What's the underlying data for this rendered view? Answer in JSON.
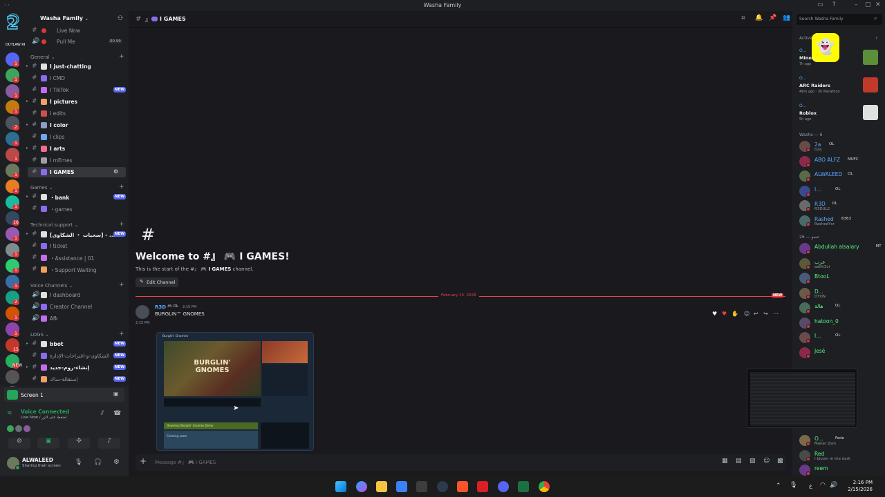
{
  "window": {
    "title": "Washa Family"
  },
  "server": {
    "name": "Washa Family",
    "guild_badges": [
      "1",
      "1",
      "1",
      "1",
      "2",
      "1",
      "1",
      "1",
      "1",
      "1",
      "16",
      "1",
      "1",
      "1",
      "1",
      "2",
      "1",
      "1",
      "15",
      "NEW"
    ],
    "guild_tag": "OUTLAW RP"
  },
  "channels_top": [
    {
      "label": "Live Now"
    },
    {
      "label": "Pull Me",
      "count": "00 99"
    }
  ],
  "categories": {
    "general": "General",
    "games": "Games",
    "support": "Technical support",
    "voice": "Voice Channels",
    "logs": "LOGS"
  },
  "channels_general": [
    {
      "label": "I just-chatting",
      "bold": true
    },
    {
      "label": "I CMD"
    },
    {
      "label": "I TikTok",
      "badge": "NEW"
    },
    {
      "label": "I pictures",
      "bold": true
    },
    {
      "label": "I edits"
    },
    {
      "label": "I color",
      "bold": true
    },
    {
      "label": "I clips"
    },
    {
      "label": "I arts",
      "bold": true
    },
    {
      "label": "I mEmes"
    },
    {
      "label": "I GAMES",
      "selected": true
    }
  ],
  "channels_games": [
    {
      "label": "・bank",
      "bold": true,
      "badge": "NEW"
    },
    {
      "label": "・games"
    }
  ],
  "channels_support": [
    {
      "label": "[سحبات ・ الشكاوى] - ...",
      "bold": true,
      "badge": "NEW"
    },
    {
      "label": "I ticket"
    },
    {
      "label": "・Assistance | 01"
    },
    {
      "label": "・Support Waiting"
    }
  ],
  "channels_voice": [
    {
      "label": "I dashboard"
    },
    {
      "label": "Creator Channel"
    },
    {
      "label": "Afk"
    }
  ],
  "channels_logs": [
    {
      "label": "bbot",
      "bold": true,
      "badge": "NEW"
    },
    {
      "label": "الشكاوى-و-اقتراحات-الإدارة",
      "badge": "NEW"
    },
    {
      "label": "إنشاء-روم-جديد",
      "bold": true,
      "badge": "NEW"
    },
    {
      "label": "إستقالة-ساك",
      "badge": "NEW"
    }
  ],
  "screen_share": {
    "label": "Screen 1"
  },
  "voice": {
    "status": "Voice Connected",
    "sub": "Live Now / اضغط على الزر"
  },
  "user": {
    "name": "ALWALEED",
    "status": "Sharing their screen"
  },
  "header": {
    "channel": "I GAMES"
  },
  "search": {
    "placeholder": "Search Washa Family"
  },
  "welcome": {
    "title": "Welcome to #』 🎮 I GAMES!",
    "subtitle_pre": "This is the start of the #』 🎮 ",
    "subtitle_bold": "I GAMES",
    "subtitle_post": " channel.",
    "edit_button": "Edit Channel"
  },
  "divider": {
    "date": "February 15, 2026",
    "badge": "NEW"
  },
  "message": {
    "author": "R3D",
    "tag": "OL",
    "time": "2:15 PM",
    "side_time": "2:15 PM",
    "text": "BURGLIN™ GNOMES"
  },
  "embed": {
    "game_title": "BURGLIN' GNOMES",
    "store_header": "Burglin' Gnomes",
    "download_label": "Download Burglin' Gnomes Demo",
    "coming_soon": "Coming soon"
  },
  "composer": {
    "placeholder": "Message #』 🎮 I GAMES"
  },
  "activity": {
    "header": "Active Now",
    "items": [
      {
        "name": "O...",
        "game": "Minec...",
        "sub": "7h ago"
      },
      {
        "name": "O...",
        "game": "ARC Raiders",
        "sub": "46m ago  ·  3h Marathon"
      },
      {
        "name": "O...",
        "game": "Roblox",
        "sub": "5h ago"
      }
    ]
  },
  "member_groups": {
    "washa": "Washa — 6",
    "other": "عضو — 26"
  },
  "members_washa": [
    {
      "name": "2a",
      "tag": "OL",
      "sub": "b2a",
      "color": "#5aa8ff"
    },
    {
      "name": "ABO ALFZ",
      "tag": "MUFC",
      "sub": "",
      "color": "#5aa8ff"
    },
    {
      "name": "ALWALEED",
      "tag": "OL",
      "sub": "",
      "color": "#5aa8ff"
    },
    {
      "name": "I...",
      "tag": "OL",
      "sub": "",
      "color": "#5aa8ff"
    },
    {
      "name": "R3D",
      "tag": "OL",
      "sub": "R3DUL2",
      "color": "#5aa8ff"
    },
    {
      "name": "Rashed",
      "tag": "6363",
      "sub": "RashedYsr",
      "color": "#5aa8ff"
    }
  ],
  "members_other": [
    {
      "name": "Abdullah alsaiary",
      "tag": "MT",
      "sub": "",
      "color": "#57f287"
    },
    {
      "name": "عرب",
      "tag": "",
      "sub": "aa0h3vl",
      "color": "#57f287"
    },
    {
      "name": "BtooL",
      "tag": "",
      "sub": "",
      "color": "#57f287"
    },
    {
      "name": "D...",
      "tag": "",
      "sub": "DTON",
      "color": "#57f287"
    },
    {
      "name": "هالة",
      "tag": "OL",
      "sub": "",
      "color": "#57f287"
    },
    {
      "name": "hatoon_0",
      "tag": "",
      "sub": "",
      "color": "#57f287"
    },
    {
      "name": "I...",
      "tag": "OL",
      "sub": "",
      "color": "#57f287"
    },
    {
      "name": "Jesé",
      "tag": "",
      "sub": "",
      "color": "#57f287"
    }
  ],
  "members_bottom": [
    {
      "name": "O...",
      "tag": "Fade",
      "sub": "Maher Zain",
      "color": "#57f287"
    },
    {
      "name": "Red",
      "tag": "",
      "sub": "I bloom in the dark",
      "color": "#57f287"
    },
    {
      "name": "reem",
      "tag": "",
      "sub": "",
      "color": "#57f287"
    }
  ],
  "taskbar": {
    "time": "2:16 PM",
    "date": "2/15/2026",
    "lang": "ع"
  },
  "colors": {
    "accent": "#5865f2",
    "new_badge": "#5865f2",
    "divider": "#f23f43",
    "voice_green": "#23a55a"
  }
}
